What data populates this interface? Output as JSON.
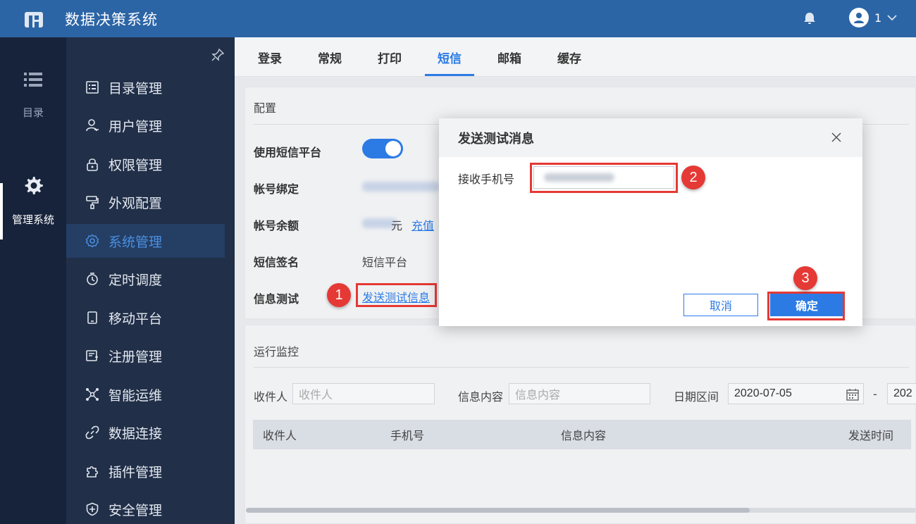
{
  "header": {
    "app_title": "数据决策系统",
    "user_name": "1"
  },
  "rail": {
    "catalog_label": "目录",
    "admin_label": "管理系统"
  },
  "sidebar": {
    "items": [
      {
        "label": "目录管理",
        "icon": "list-doc-icon"
      },
      {
        "label": "用户管理",
        "icon": "user-icon"
      },
      {
        "label": "权限管理",
        "icon": "lock-icon"
      },
      {
        "label": "外观配置",
        "icon": "paint-roller-icon"
      },
      {
        "label": "系统管理",
        "icon": "gear-icon",
        "active": true
      },
      {
        "label": "定时调度",
        "icon": "stopwatch-icon"
      },
      {
        "label": "移动平台",
        "icon": "tablet-icon"
      },
      {
        "label": "注册管理",
        "icon": "register-icon"
      },
      {
        "label": "智能运维",
        "icon": "network-icon"
      },
      {
        "label": "数据连接",
        "icon": "link-icon"
      },
      {
        "label": "插件管理",
        "icon": "puzzle-icon"
      },
      {
        "label": "安全管理",
        "icon": "shield-icon"
      }
    ]
  },
  "tabs": [
    "登录",
    "常规",
    "打印",
    "短信",
    "邮箱",
    "缓存"
  ],
  "active_tab": "短信",
  "config": {
    "title": "配置",
    "sms_platform_label": "使用短信平台",
    "account_binding_label": "帐号绑定",
    "account_balance_label": "帐号余额",
    "balance_unit": "元",
    "recharge_link": "充值",
    "sms_signature_label": "短信签名",
    "sms_signature_value": "短信平台",
    "info_test_label": "信息测试",
    "send_test_link": "发送测试信息"
  },
  "monitor": {
    "title": "运行监控",
    "recipient_label": "收件人",
    "recipient_placeholder": "收件人",
    "content_label": "信息内容",
    "content_placeholder": "信息内容",
    "date_range_label": "日期区间",
    "date_start": "2020-07-05",
    "date_separator": "-",
    "date_end_partial": "202",
    "columns": [
      "收件人",
      "手机号",
      "信息内容",
      "发送时间"
    ]
  },
  "dialog": {
    "title": "发送测试消息",
    "phone_label": "接收手机号",
    "cancel_label": "取消",
    "ok_label": "确定"
  },
  "annotations": [
    "1",
    "2",
    "3"
  ],
  "colors": {
    "topbar": "#2c65a6",
    "accent": "#2c7be5",
    "highlight": "#e53935",
    "sidebar": "#212f48",
    "rail": "#17233b"
  }
}
